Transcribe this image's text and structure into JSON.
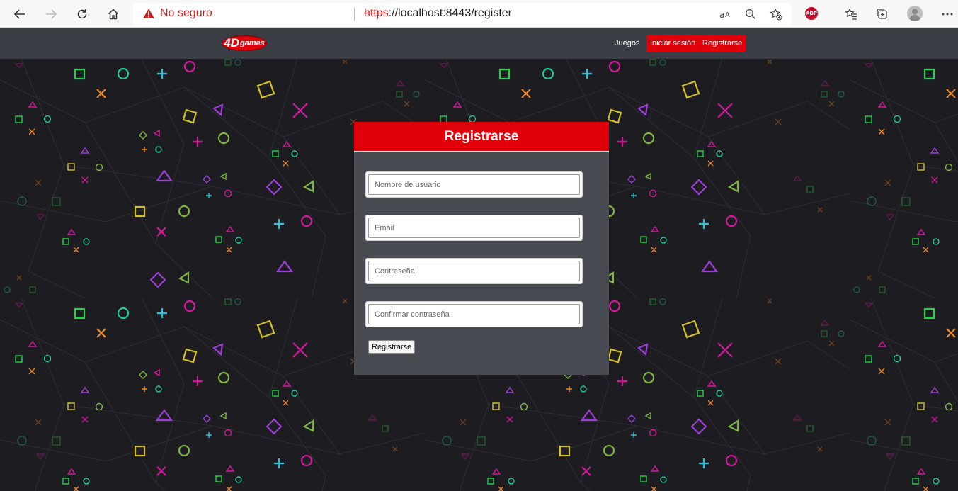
{
  "browser": {
    "insecure_label": "No seguro",
    "url_scheme": "https",
    "url_rest": "://localhost:8443/register",
    "adblock_label": "ABP"
  },
  "site": {
    "logo_number": "4D",
    "logo_text": "games",
    "nav": {
      "games": "Juegos",
      "login": "Iniciar sesión",
      "register": "Registrarse"
    }
  },
  "form": {
    "title": "Registrarse",
    "username_placeholder": "Nombre de usuario",
    "email_placeholder": "Email",
    "password_placeholder": "Contraseña",
    "confirm_placeholder": "Confirmar contraseña",
    "submit_label": "Registrarse"
  },
  "colors": {
    "brand_red": "#e0000a",
    "navbar": "#3a3d44",
    "card": "#474a51",
    "background": "#1c1c21"
  }
}
